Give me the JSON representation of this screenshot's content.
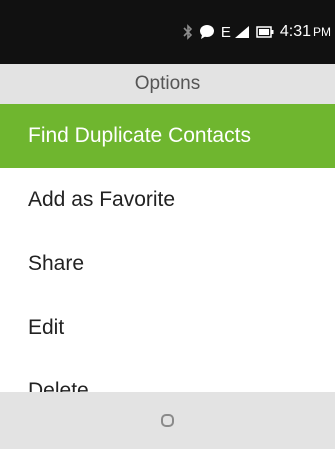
{
  "status_bar": {
    "icons": [
      "bluetooth-icon",
      "chat-bubble-icon",
      "signal-icon",
      "battery-icon"
    ],
    "network_type": "E",
    "time": "4:31",
    "ampm": "PM",
    "background": "#111111"
  },
  "header": {
    "title": "Options"
  },
  "menu": {
    "items": [
      {
        "label": "Find Duplicate Contacts",
        "selected": true
      },
      {
        "label": "Add as Favorite",
        "selected": false
      },
      {
        "label": "Share",
        "selected": false
      },
      {
        "label": "Edit",
        "selected": false
      },
      {
        "label": "Delete",
        "selected": false
      }
    ],
    "highlight_color": "#6fb62f"
  },
  "softkeys": {
    "center_icon": "home-circle-icon"
  }
}
